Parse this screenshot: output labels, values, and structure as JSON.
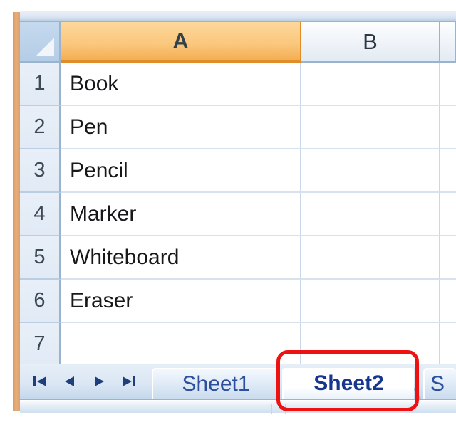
{
  "spreadsheet": {
    "select_all_corner": "select-all",
    "columns": [
      {
        "label": "A",
        "selected": true
      },
      {
        "label": "B",
        "selected": false
      },
      {
        "label": "",
        "selected": false
      }
    ],
    "rows": [
      {
        "number": "1",
        "a": "Book",
        "b": "",
        "c": ""
      },
      {
        "number": "2",
        "a": "Pen",
        "b": "",
        "c": ""
      },
      {
        "number": "3",
        "a": "Pencil",
        "b": "",
        "c": ""
      },
      {
        "number": "4",
        "a": "Marker",
        "b": "",
        "c": ""
      },
      {
        "number": "5",
        "a": "Whiteboard",
        "b": "",
        "c": ""
      },
      {
        "number": "6",
        "a": "Eraser",
        "b": "",
        "c": ""
      },
      {
        "number": "7",
        "a": "",
        "b": "",
        "c": ""
      }
    ]
  },
  "tab_bar": {
    "nav_buttons": [
      {
        "name": "first-sheet-icon",
        "glyph": "|◀"
      },
      {
        "name": "previous-sheet-icon",
        "glyph": "◀"
      },
      {
        "name": "next-sheet-icon",
        "glyph": "▶"
      },
      {
        "name": "last-sheet-icon",
        "glyph": "▶|"
      }
    ],
    "tabs": [
      {
        "label": "Sheet1",
        "active": false
      },
      {
        "label": "Sheet2",
        "active": true
      },
      {
        "label": "S",
        "active": false
      }
    ]
  },
  "annotation": {
    "shape": "rounded-rectangle",
    "color": "#ee1111",
    "target": "Sheet2"
  },
  "colors": {
    "selected_column_header": "#f3ae52",
    "header_border": "#9ab4d0",
    "row_header_bg": "#e4edf6",
    "tab_text": "#2c4f9e",
    "active_tab_text": "#17368f",
    "left_selection_strip": "#e0a573",
    "annotation": "#ee1111"
  }
}
